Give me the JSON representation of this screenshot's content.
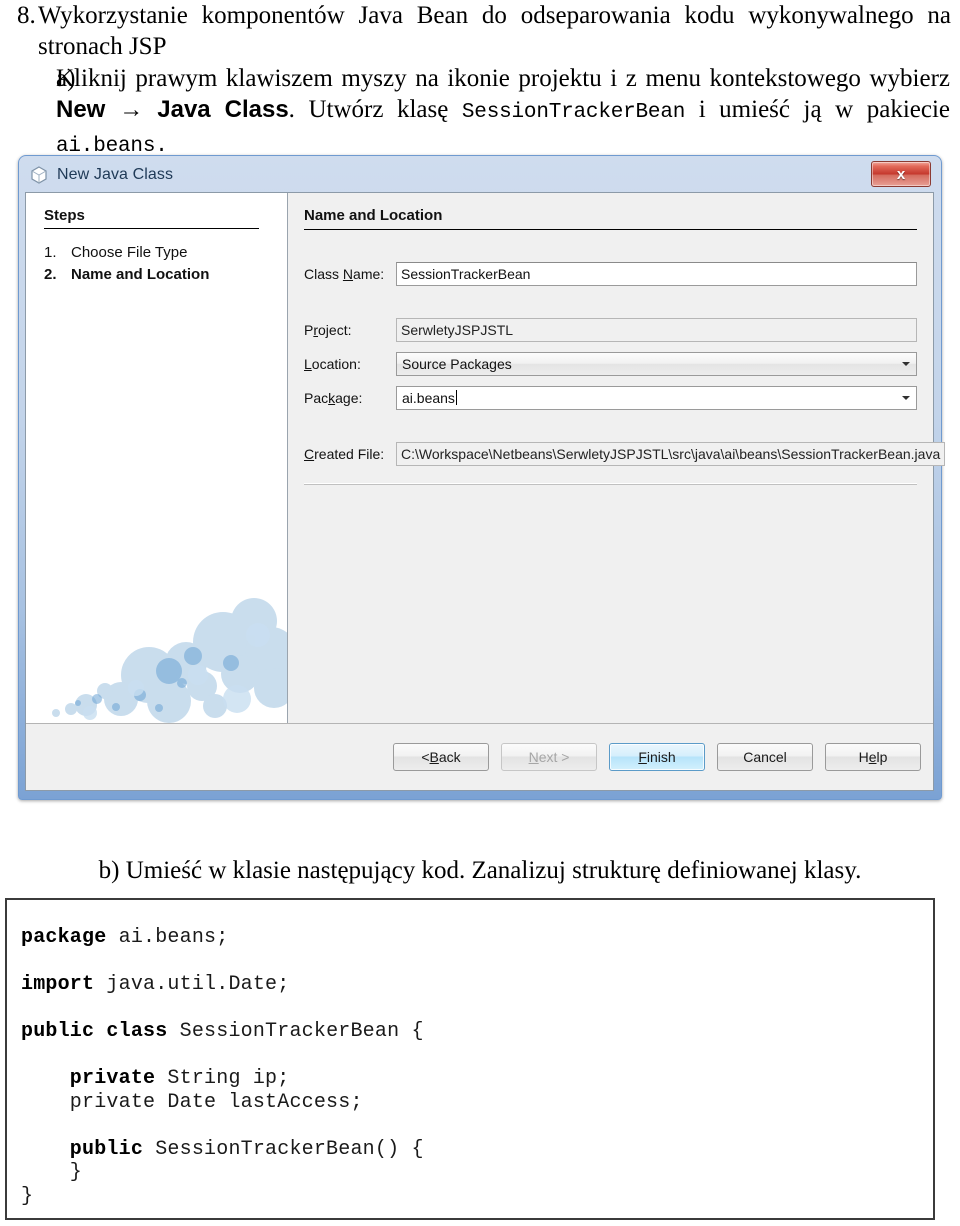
{
  "document": {
    "item_number": "8.",
    "item_title": "Wykorzystanie komponentów Java Bean do odseparowania kodu wykonywalnego na stronach JSP",
    "sub_a_marker": "a)",
    "sub_a_text_1": "Kliknij prawym klawiszem myszy na ikonie projektu i z menu kontekstowego wybierz",
    "sub_a_menu": "New → Java Class",
    "sub_a_text_2": ". Utwórz klasę ",
    "sub_a_class": "SessionTrackerBean",
    "sub_a_text_3": " i umieść ją w pakiecie ",
    "sub_a_package": "ai.beans.",
    "sub_b_text": "b) Umieść w klasie następujący kod. Zanalizuj strukturę definiowanej klasy."
  },
  "dialog": {
    "title": "New Java Class",
    "window_icon": "java-class-icon",
    "close_label": "x",
    "steps": {
      "heading": "Steps",
      "items": [
        {
          "index": "1.",
          "label": "Choose File Type",
          "current": false
        },
        {
          "index": "2.",
          "label": "Name and Location",
          "current": true
        }
      ]
    },
    "form": {
      "heading": "Name and Location",
      "fields": [
        {
          "name": "class-name",
          "label_pre": "Class ",
          "label_key": "N",
          "label_post": "ame:",
          "value": "SessionTrackerBean",
          "control": "text",
          "readonly": false,
          "caret": false
        },
        {
          "name": "project",
          "label_pre": "P",
          "label_key": "r",
          "label_post": "oject:",
          "value": "SerwletyJSPJSTL",
          "control": "text",
          "readonly": true,
          "caret": false
        },
        {
          "name": "location",
          "label_pre": "",
          "label_key": "L",
          "label_post": "ocation:",
          "value": "Source Packages",
          "control": "combo",
          "editable": false,
          "caret": false
        },
        {
          "name": "package",
          "label_pre": "Pac",
          "label_key": "k",
          "label_post": "age:",
          "value": "ai.beans",
          "control": "combo",
          "editable": true,
          "caret": true
        },
        {
          "name": "created-file",
          "label_pre": "",
          "label_key": "C",
          "label_post": "reated File:",
          "value": "C:\\Workspace\\Netbeans\\SerwletyJSPJSTL\\src\\java\\ai\\beans\\SessionTrackerBean.java",
          "control": "text",
          "readonly": true,
          "caret": false
        }
      ]
    },
    "buttons": [
      {
        "name": "back",
        "pre": "< ",
        "key": "B",
        "post": "ack",
        "state": "enabled"
      },
      {
        "name": "next",
        "pre": "",
        "key": "N",
        "post": "ext >",
        "state": "disabled"
      },
      {
        "name": "finish",
        "pre": "",
        "key": "F",
        "post": "inish",
        "state": "default"
      },
      {
        "name": "cancel",
        "pre": "Cancel",
        "key": "",
        "post": "",
        "state": "enabled"
      },
      {
        "name": "help",
        "pre": "H",
        "key": "e",
        "post": "lp",
        "state": "enabled"
      }
    ]
  },
  "code": {
    "lines": [
      {
        "bold": "package",
        "rest": " ai.beans;"
      },
      {
        "bold": "",
        "rest": ""
      },
      {
        "bold": "import",
        "rest": " java.util.Date;"
      },
      {
        "bold": "",
        "rest": ""
      },
      {
        "bold": "public class",
        "rest": " SessionTrackerBean {"
      },
      {
        "bold": "",
        "rest": ""
      },
      {
        "bold": "    private",
        "rest": " String ip;"
      },
      {
        "bold": "",
        "rest": "    private Date lastAccess;"
      },
      {
        "bold": "",
        "rest": ""
      },
      {
        "bold": "    public",
        "rest": " SessionTrackerBean() {"
      },
      {
        "bold": "",
        "rest": "    }"
      },
      {
        "bold": "",
        "rest": "}"
      }
    ]
  },
  "colors": {
    "accent_blue": "#7ba2d4",
    "close_red": "#c3352a",
    "default_button_blue": "#b6e3fa",
    "bubble_blue": "#9dc2e0"
  }
}
